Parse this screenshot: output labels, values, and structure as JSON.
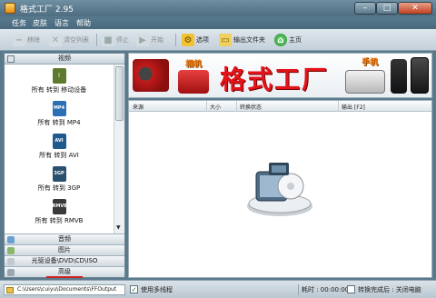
{
  "window": {
    "title": "格式工厂 2.95"
  },
  "menu": [
    "任务",
    "皮肤",
    "语言",
    "帮助"
  ],
  "toolbar": {
    "remove": "移除",
    "clear": "清空列表",
    "stop": "停止",
    "start": "开始",
    "options": "选项",
    "output_folder": "输出文件夹",
    "home": "主页"
  },
  "sidebar": {
    "video_header": "视频",
    "items": [
      {
        "label": "所有 转到 移动设备",
        "badge": "",
        "color": "#5d7a2e"
      },
      {
        "label": "所有 转到 MP4",
        "badge": "MP4",
        "color": "#2b6fb5"
      },
      {
        "label": "所有 转到 AVI",
        "badge": "AVI",
        "color": "#1f5a8f"
      },
      {
        "label": "所有 转到 3GP",
        "badge": "3GP",
        "color": "#2b4f6e"
      },
      {
        "label": "所有 转到 RMVB",
        "badge": "RMVB",
        "color": "#3a3a3a"
      }
    ],
    "sections": [
      "音频",
      "图片",
      "光驱设备\\DVD\\CD\\ISO",
      "高级"
    ]
  },
  "banner": {
    "title": "格式工厂",
    "tag_camera": "相机",
    "tag_phone": "手机"
  },
  "table": {
    "columns": [
      "来源",
      "大小",
      "转换状态",
      "输出 [F2]"
    ]
  },
  "status": {
    "output_path": "C:\\Users\\cuiyu\\Documents\\FFOutput",
    "multithread_label": "使用多线程",
    "elapsed_label": "耗时 : 00:00:00",
    "after_label": "转换完成后 : 关闭电脑"
  },
  "colors": {
    "accent_red": "#e3131a",
    "chrome_blue": "#5a7a8c"
  }
}
